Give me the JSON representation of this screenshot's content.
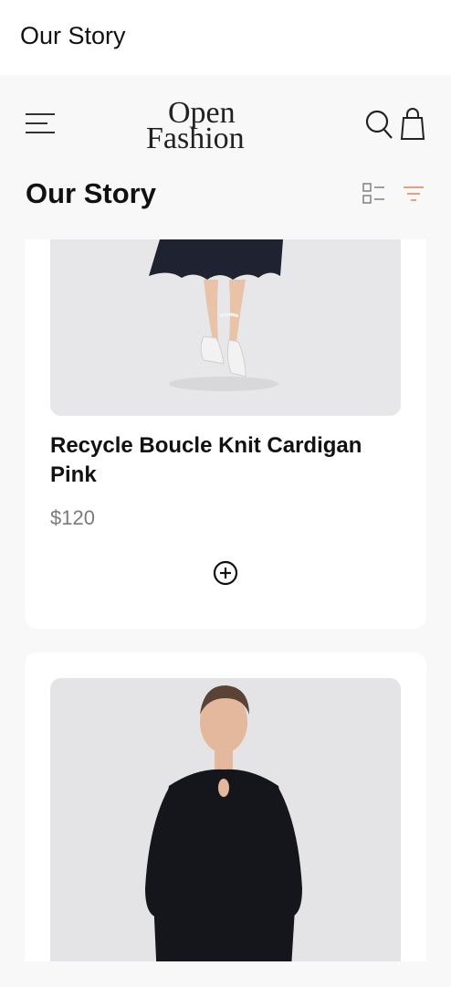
{
  "app_bar": {
    "title": "Our Story"
  },
  "header": {
    "logo_line1": "Open",
    "logo_line2": "Fashion"
  },
  "page": {
    "title": "Our Story"
  },
  "products": [
    {
      "name": "Recycle Boucle Knit Cardigan Pink",
      "price": "$120"
    },
    {
      "name": "",
      "price": ""
    }
  ],
  "icons": {
    "menu": "menu-icon",
    "search": "search-icon",
    "bag": "shopping-bag-icon",
    "list_view": "list-view-icon",
    "filter": "filter-icon",
    "add": "add-circle-icon"
  },
  "colors": {
    "accent": "#e8a07a",
    "background": "#f8f8f8",
    "card": "#ffffff",
    "price": "#7a7a7a"
  }
}
